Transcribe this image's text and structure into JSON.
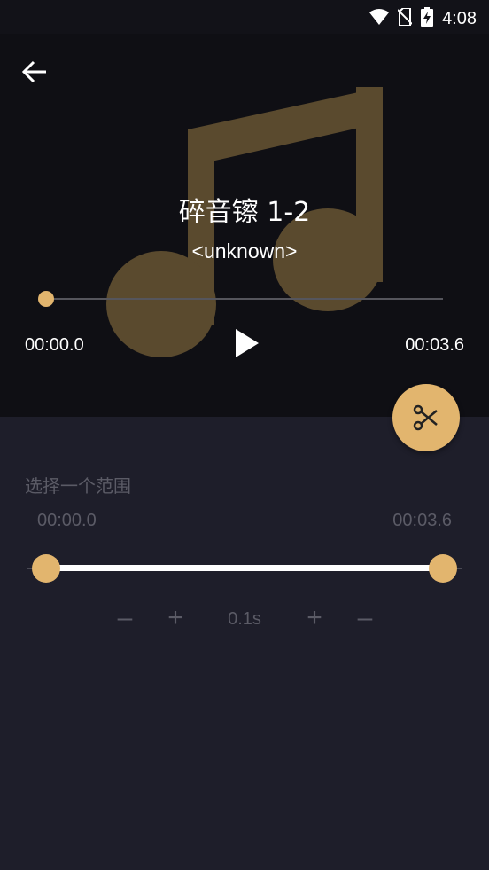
{
  "status_bar": {
    "time": "4:08",
    "icons": [
      "wifi-icon",
      "no-sim-icon",
      "battery-charging-icon"
    ]
  },
  "header": {
    "back_icon": "arrow-left-icon"
  },
  "track": {
    "title": "碎音镲 1-2",
    "artist": "<unknown>",
    "current_time": "00:00.0",
    "total_time": "00:03.6",
    "progress": 0
  },
  "controls": {
    "play_icon": "play-icon",
    "cut_icon": "scissors-icon"
  },
  "range": {
    "label": "选择一个范围",
    "start": "00:00.0",
    "end": "00:03.6",
    "start_fraction": 0,
    "end_fraction": 1,
    "step_value": "0.1s",
    "minus_label": "–",
    "plus_label": "+"
  },
  "colors": {
    "accent": "#e2b56e",
    "player_bg": "#0f0f14",
    "panel_bg": "#1e1e2a",
    "muted_text": "#5b5b66"
  }
}
